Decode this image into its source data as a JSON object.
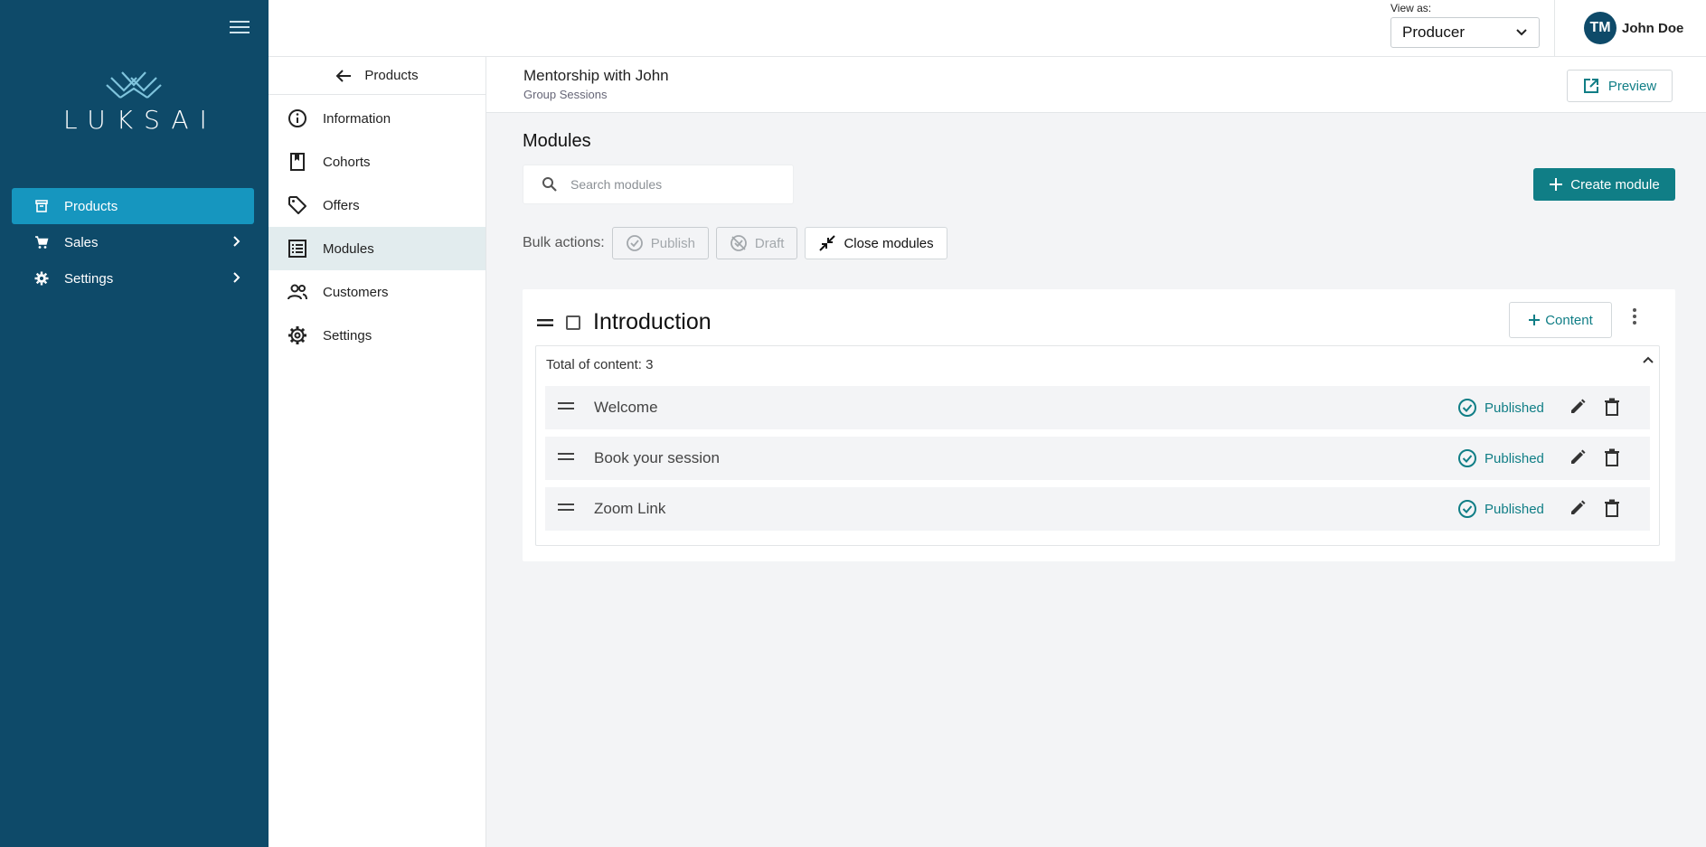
{
  "brand": {
    "logo_text": "LUKSAI"
  },
  "sidebar": {
    "items": [
      {
        "label": "Products",
        "icon": "box-icon",
        "active": true
      },
      {
        "label": "Sales",
        "icon": "cart-icon",
        "has_children": true
      },
      {
        "label": "Settings",
        "icon": "gear-icon",
        "has_children": true
      }
    ]
  },
  "topbar": {
    "view_as_label": "View as:",
    "view_as_value": "Producer",
    "user_initials": "TM",
    "user_name": "John Doe"
  },
  "subnav": {
    "back_label": "Products",
    "items": [
      {
        "label": "Information",
        "icon": "info-icon"
      },
      {
        "label": "Cohorts",
        "icon": "book-icon"
      },
      {
        "label": "Offers",
        "icon": "tag-icon"
      },
      {
        "label": "Modules",
        "icon": "list-icon",
        "active": true
      },
      {
        "label": "Customers",
        "icon": "people-icon"
      },
      {
        "label": "Settings",
        "icon": "gear-icon"
      }
    ]
  },
  "header": {
    "title": "Mentorship with John",
    "subtitle": "Group Sessions",
    "preview_label": "Preview"
  },
  "main": {
    "title": "Modules",
    "search_placeholder": "Search modules",
    "create_label": "Create module",
    "bulk_label": "Bulk actions:",
    "bulk_publish": "Publish",
    "bulk_draft": "Draft",
    "bulk_close": "Close modules"
  },
  "module": {
    "title": "Introduction",
    "content_button": "Content",
    "total_label": "Total of content: 3",
    "items": [
      {
        "title": "Welcome",
        "status": "Published"
      },
      {
        "title": "Book your session",
        "status": "Published"
      },
      {
        "title": "Zoom Link",
        "status": "Published"
      }
    ]
  },
  "colors": {
    "sidebar_bg": "#0e4a69",
    "sidebar_active": "#1696bf",
    "accent_teal": "#107e86",
    "page_bg": "#f3f4f6"
  }
}
